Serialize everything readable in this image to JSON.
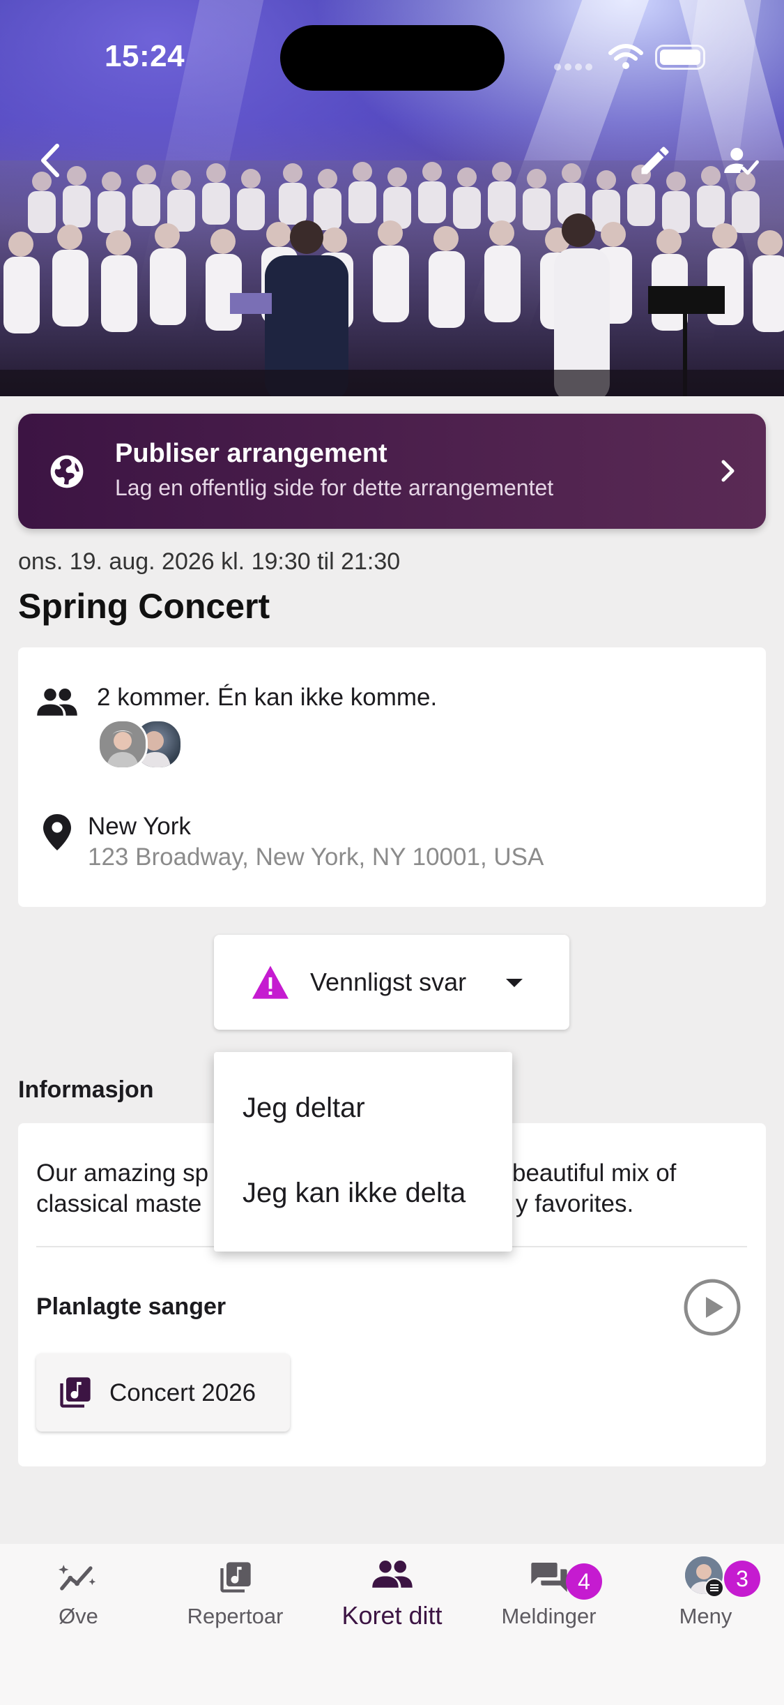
{
  "status_bar": {
    "time": "15:24"
  },
  "hero": {
    "back_icon": "chevron-left-icon",
    "edit_icon": "pencil-icon",
    "attendance_icon": "person-check-icon"
  },
  "publish_banner": {
    "title": "Publiser arrangement",
    "subtitle": "Lag en offentlig side for dette arrangementet",
    "icon": "globe-icon",
    "chevron_icon": "chevron-right-icon"
  },
  "event": {
    "date": "ons. 19. aug. 2026 kl. 19:30 til 21:30",
    "title": "Spring Concert",
    "attendance": "2 kommer. Én kan ikke komme.",
    "location_name": "New York",
    "location_address": "123 Broadway, New York, NY 10001, USA"
  },
  "rsvp": {
    "label": "Vennligst svar",
    "warning_color": "#c51bd0"
  },
  "info": {
    "heading": "Informasjon",
    "description_left_1": "Our amazing sp",
    "description_right_1": "beautiful mix of",
    "description_left_2": "classical maste",
    "description_right_2": "y favorites.",
    "songs_heading": "Planlagte sanger",
    "playlist": "Concert 2026"
  },
  "dropdown": {
    "options": [
      "Jeg deltar",
      "Jeg kan ikke delta"
    ]
  },
  "nav": {
    "items": [
      {
        "label": "Øve",
        "icon": "trend-sparkle-icon"
      },
      {
        "label": "Repertoar",
        "icon": "music-library-icon"
      },
      {
        "label": "Koret ditt",
        "icon": "group-icon",
        "active": true
      },
      {
        "label": "Meldinger",
        "icon": "chat-icon",
        "badge": "4"
      },
      {
        "label": "Meny",
        "icon": "avatar",
        "badge": "3"
      }
    ]
  },
  "colors": {
    "brand": "#3c1443",
    "accent": "#c51bd0",
    "background": "#efeeee"
  }
}
